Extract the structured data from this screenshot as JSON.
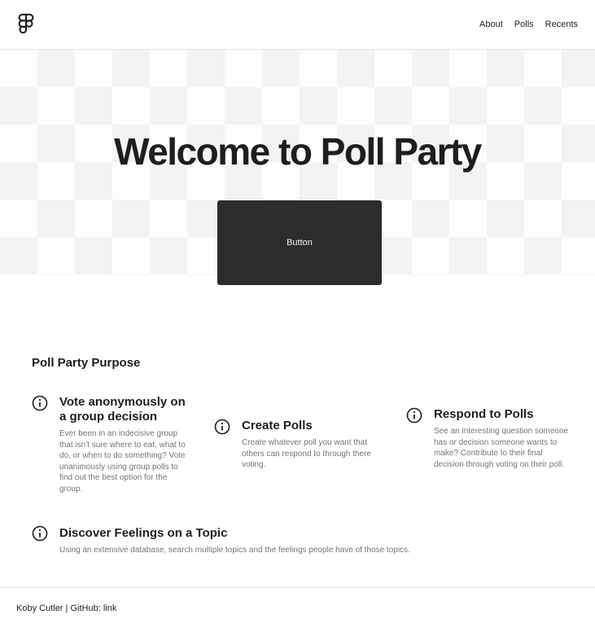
{
  "nav": {
    "items": [
      "About",
      "Polls",
      "Recents"
    ]
  },
  "hero": {
    "title": "Welcome to Poll Party",
    "button_label": "Button"
  },
  "purpose": {
    "title": "Poll Party Purpose"
  },
  "features": [
    {
      "title": "Vote anonymously on a group decision",
      "description": "Ever been in an indecisive group that isn't sure where to eat, what to do, or when to do something? Vote unanimously using group polls to find out the best option for the group.",
      "icon": "info-icon"
    },
    {
      "title": "Create Polls",
      "description": "Create whatever poll you want that others can respond to through there voting.",
      "icon": "info-icon"
    },
    {
      "title": "Respond to Polls",
      "description": "See an interesting question someone has or decision someone wants to make? Contribute to their final decision through voting on their poll.",
      "icon": "info-icon"
    },
    {
      "title": "Discover Feelings on a Topic",
      "description": "Using an extensive database, search multiple topics and the feelings people have of those topics.",
      "icon": "info-icon"
    }
  ],
  "footer": {
    "author": "Koby Cutler",
    "separator": "|",
    "github_label": "GitHub:",
    "link_label": "link"
  },
  "colors": {
    "text": "#1e1e1e",
    "muted": "#757575",
    "button": "#2c2c2c",
    "button_text": "#f5f5f5"
  }
}
